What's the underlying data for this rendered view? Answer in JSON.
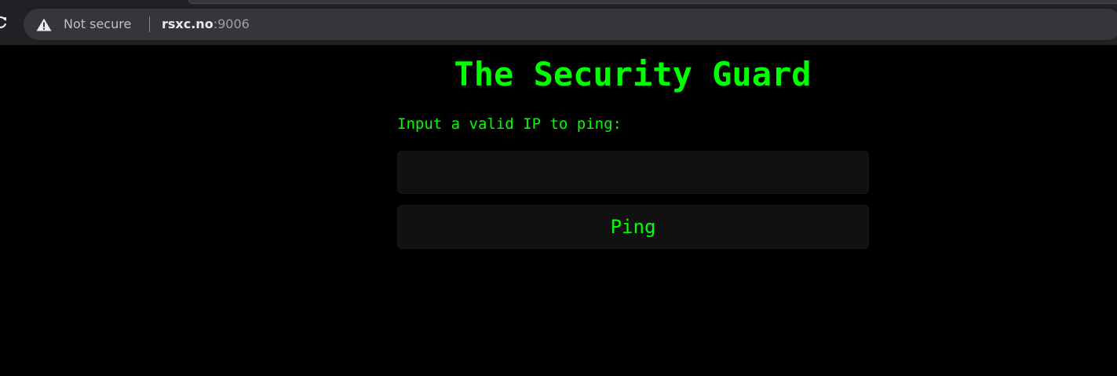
{
  "browser": {
    "security_label": "Not secure",
    "url_host": "rsxc.no",
    "url_port": ":9006",
    "icons": {
      "reload": "reload-icon",
      "warning": "warning-icon"
    },
    "colors": {
      "toolbar": "#202124",
      "omnibox": "#35363a"
    }
  },
  "page": {
    "title": "The Security Guard",
    "prompt": "Input a valid IP to ping:",
    "input_value": "",
    "input_placeholder": "",
    "button_label": "Ping",
    "colors": {
      "background": "#000000",
      "text": "#00ff00",
      "field": "#111111"
    }
  }
}
